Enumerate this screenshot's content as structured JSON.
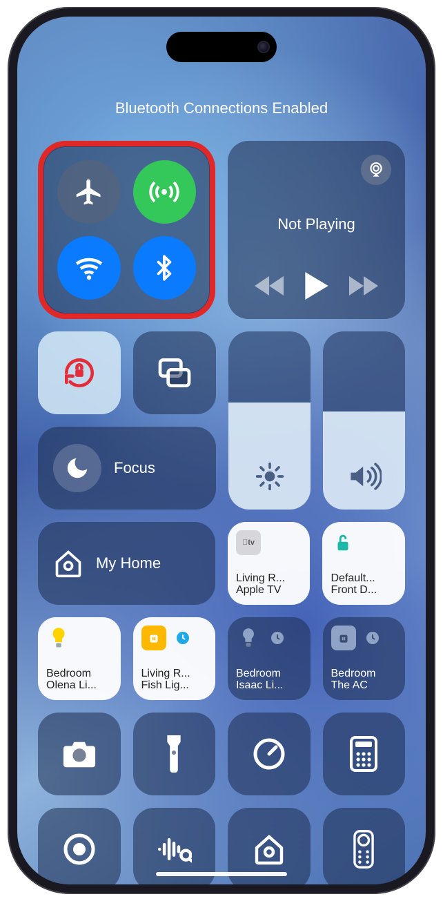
{
  "status": "Bluetooth Connections Enabled",
  "connectivity": {
    "airplane": {
      "on": false
    },
    "cellular": {
      "on": true
    },
    "wifi": {
      "on": true
    },
    "bluetooth": {
      "on": true
    }
  },
  "media": {
    "title": "Not Playing"
  },
  "focus": {
    "label": "Focus"
  },
  "brightness_percent": 60,
  "volume_percent": 55,
  "home": {
    "label": "My Home"
  },
  "accessories": [
    {
      "key": "appletv",
      "line1": "Living R...",
      "line2": "Apple TV",
      "light": true,
      "icon": "appletv"
    },
    {
      "key": "frontdoor",
      "line1": "Default...",
      "line2": "Front D...",
      "light": true,
      "icon": "lock-open"
    },
    {
      "key": "bedroom1",
      "line1": "Bedroom",
      "line2": "Olena Li...",
      "light": true,
      "icon": "bulb-on"
    },
    {
      "key": "living1",
      "line1": "Living R...",
      "line2": "Fish Lig...",
      "light": true,
      "icon": "plug-on"
    },
    {
      "key": "bedroom2",
      "line1": "Bedroom",
      "line2": "Isaac Li...",
      "light": false,
      "icon": "bulb-off"
    },
    {
      "key": "bedroom3",
      "line1": "Bedroom",
      "line2": "The AC",
      "light": false,
      "icon": "plug-off"
    }
  ],
  "utilities_row1": [
    {
      "key": "camera",
      "icon": "camera"
    },
    {
      "key": "flashlight",
      "icon": "flashlight"
    },
    {
      "key": "timer",
      "icon": "timer"
    },
    {
      "key": "calculator",
      "icon": "calculator"
    }
  ],
  "utilities_row2": [
    {
      "key": "screenrec",
      "icon": "record"
    },
    {
      "key": "shazam",
      "icon": "shazam"
    },
    {
      "key": "homeapp",
      "icon": "home"
    },
    {
      "key": "tvremote",
      "icon": "remote"
    }
  ]
}
